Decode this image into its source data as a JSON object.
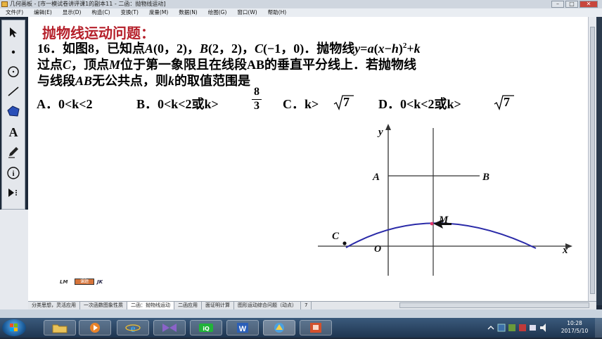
{
  "window": {
    "title": "几何画板 - [市一模试卷讲评课1的副本11 - 二函：抛物线运动]"
  },
  "menu": [
    "文件(F)",
    "编辑(E)",
    "显示(D)",
    "构造(C)",
    "变换(T)",
    "度量(M)",
    "数据(N)",
    "绘图(G)",
    "窗口(W)",
    "帮助(H)"
  ],
  "tools": [
    "arrow-tool",
    "point-tool",
    "compass-tool",
    "straightedge-tool",
    "polygon-tool",
    "text-tool",
    "marker-tool",
    "info-tool",
    "custom-tool"
  ],
  "problem": {
    "heading": "抛物线运动问题：",
    "line1_a": "16．如图8，已知点",
    "line1_b": "A",
    "line1_c": "(0，2)，",
    "line1_d": "B",
    "line1_e": "(2，2)，",
    "line1_f": "C",
    "line1_g": "(−1，0)．抛物线",
    "line1_h": "y",
    "line1_i": "=",
    "line1_j": "a",
    "line1_k": "(",
    "line1_l": "x",
    "line1_m": "−",
    "line1_n": "h",
    "line1_o": ")",
    "line1_p": "2",
    "line1_q": "+",
    "line1_r": "k",
    "line2_a": "过点",
    "line2_b": "C",
    "line2_c": "，顶点",
    "line2_d": "M",
    "line2_e": "位于第一象限且在线段AB的垂直平分线上．若抛物线",
    "line3_a": "与线段",
    "line3_b": "AB",
    "line3_c": "无公共点，则",
    "line3_d": "k",
    "line3_e": "的取值范围是"
  },
  "options": {
    "a_label": "A．",
    "a_text": "0<k<2",
    "b_label": "B．",
    "b_text": "0<k<2或k>",
    "b_num": "8",
    "b_den": "3",
    "c_label": "C．",
    "c_text": "k>",
    "c_rad": "7",
    "d_label": "D．",
    "d_text": "0<k<2或k>",
    "d_rad": "7"
  },
  "figure": {
    "y_label": "y",
    "x_label": "x",
    "a_label": "A",
    "b_label": "B",
    "c_label": "C",
    "m_label": "M",
    "o_label": "O",
    "curve_color": "#2a2aa8"
  },
  "logos": {
    "lm": "LM",
    "mid": "课题",
    "jk": "JK"
  },
  "tabs": [
    "分类思想，灵活应用",
    "一次函数图象性质",
    "二函：抛物线运动",
    "二函应用",
    "面证明计算",
    "图形运动综合问题（动点）",
    "7"
  ],
  "taskbar": {
    "apps": [
      "folder-app",
      "media-player-app",
      "ie-browser-app",
      "bowtie-app",
      "iqiyi-app",
      "word-app",
      "geometry-sketchpad-app",
      "powerpoint-app"
    ],
    "time": "10:28",
    "date": "2017/5/10"
  }
}
